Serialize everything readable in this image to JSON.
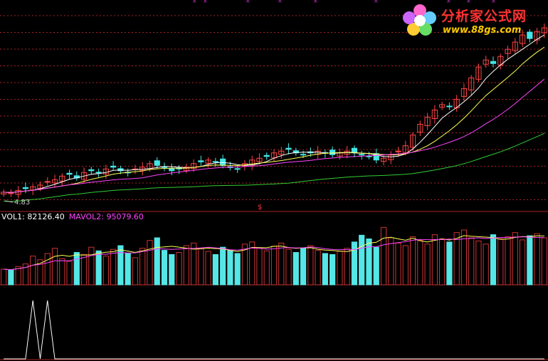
{
  "colors": {
    "background": "#000000",
    "up_candle": "#ff4444",
    "down_candle": "#44e6e6",
    "ma_short": "#ffffff",
    "ma_mid": "#ffff55",
    "ma_long_magenta": "#ff44ff",
    "ma_long_green": "#33cc33",
    "grid": "#aa2222",
    "vol_up": "#cc3333",
    "vol_down": "#55e6e6",
    "indicator": "#ffffff"
  },
  "watermark": {
    "title": "分析家公式网",
    "url": "www.88gs.com",
    "icon": "flower-logo-icon"
  },
  "price_panel": {
    "low_label": "4.83",
    "marker_glyph": "$"
  },
  "volume_panel": {
    "mavol1_label": "VOL1: 82126.40",
    "mavol2_label": "MAVOL2: 95079.60"
  },
  "chart_data": [
    {
      "type": "candlestick",
      "panel": "price",
      "title": "",
      "series": [
        {
          "name": "",
          "kind": "close",
          "values": [
            4.9,
            4.88,
            4.95,
            5.0,
            5.05,
            5.1,
            5.2,
            5.25,
            5.35,
            5.4,
            5.3,
            5.45,
            5.5,
            5.45,
            5.55,
            5.6,
            5.5,
            5.45,
            5.55,
            5.6,
            5.7,
            5.65,
            5.6,
            5.5,
            5.55,
            5.6,
            5.7,
            5.75,
            5.8,
            5.75,
            5.65,
            5.6,
            5.55,
            5.7,
            5.8,
            5.85,
            5.9,
            6.0,
            6.05,
            6.1,
            6.0,
            5.95,
            6.0,
            6.05,
            6.0,
            5.95,
            6.0,
            6.05,
            6.0,
            5.95,
            5.9,
            5.8,
            5.85,
            5.95,
            6.05,
            6.2,
            6.5,
            6.8,
            7.0,
            7.2,
            7.35,
            7.3,
            7.5,
            7.8,
            8.1,
            8.4,
            8.6,
            8.5,
            8.7,
            8.9,
            9.1,
            9.3,
            9.2,
            9.4,
            9.5
          ]
        }
      ],
      "annotations": [
        "4.83"
      ]
    },
    {
      "type": "bar",
      "panel": "volume",
      "series": [
        {
          "name": "",
          "values": [
            30,
            28,
            35,
            40,
            55,
            48,
            60,
            70,
            50,
            45,
            62,
            58,
            72,
            65,
            55,
            68,
            75,
            60,
            52,
            70,
            85,
            90,
            66,
            58,
            62,
            75,
            80,
            70,
            64,
            58,
            72,
            66,
            60,
            78,
            82,
            70,
            65,
            74,
            80,
            68,
            62,
            70,
            75,
            66,
            60,
            58,
            64,
            70,
            82,
            95,
            88,
            72,
            110,
            90,
            80,
            75,
            92,
            85,
            78,
            96,
            88,
            82,
            100,
            105,
            90,
            84,
            78,
            96,
            88,
            92,
            100,
            86,
            94,
            98,
            90
          ]
        }
      ]
    },
    {
      "type": "line",
      "panel": "indicator",
      "series": [
        {
          "name": "",
          "values": [
            0,
            0,
            0,
            0,
            1,
            0,
            1,
            0,
            0,
            0,
            0,
            0,
            0,
            0,
            0,
            0,
            0,
            0,
            0,
            0,
            0,
            0,
            0,
            0,
            0,
            0,
            0,
            0,
            0,
            0,
            0,
            0,
            0,
            0,
            0,
            0,
            0,
            0,
            0,
            0,
            0,
            0,
            0,
            0,
            0,
            0,
            0,
            0,
            0,
            0,
            0,
            0,
            0,
            0,
            0,
            0,
            0,
            0,
            0,
            0,
            0,
            0,
            0,
            0,
            0,
            0,
            0,
            0,
            0,
            0,
            0,
            0,
            0,
            0,
            0
          ]
        }
      ]
    }
  ]
}
